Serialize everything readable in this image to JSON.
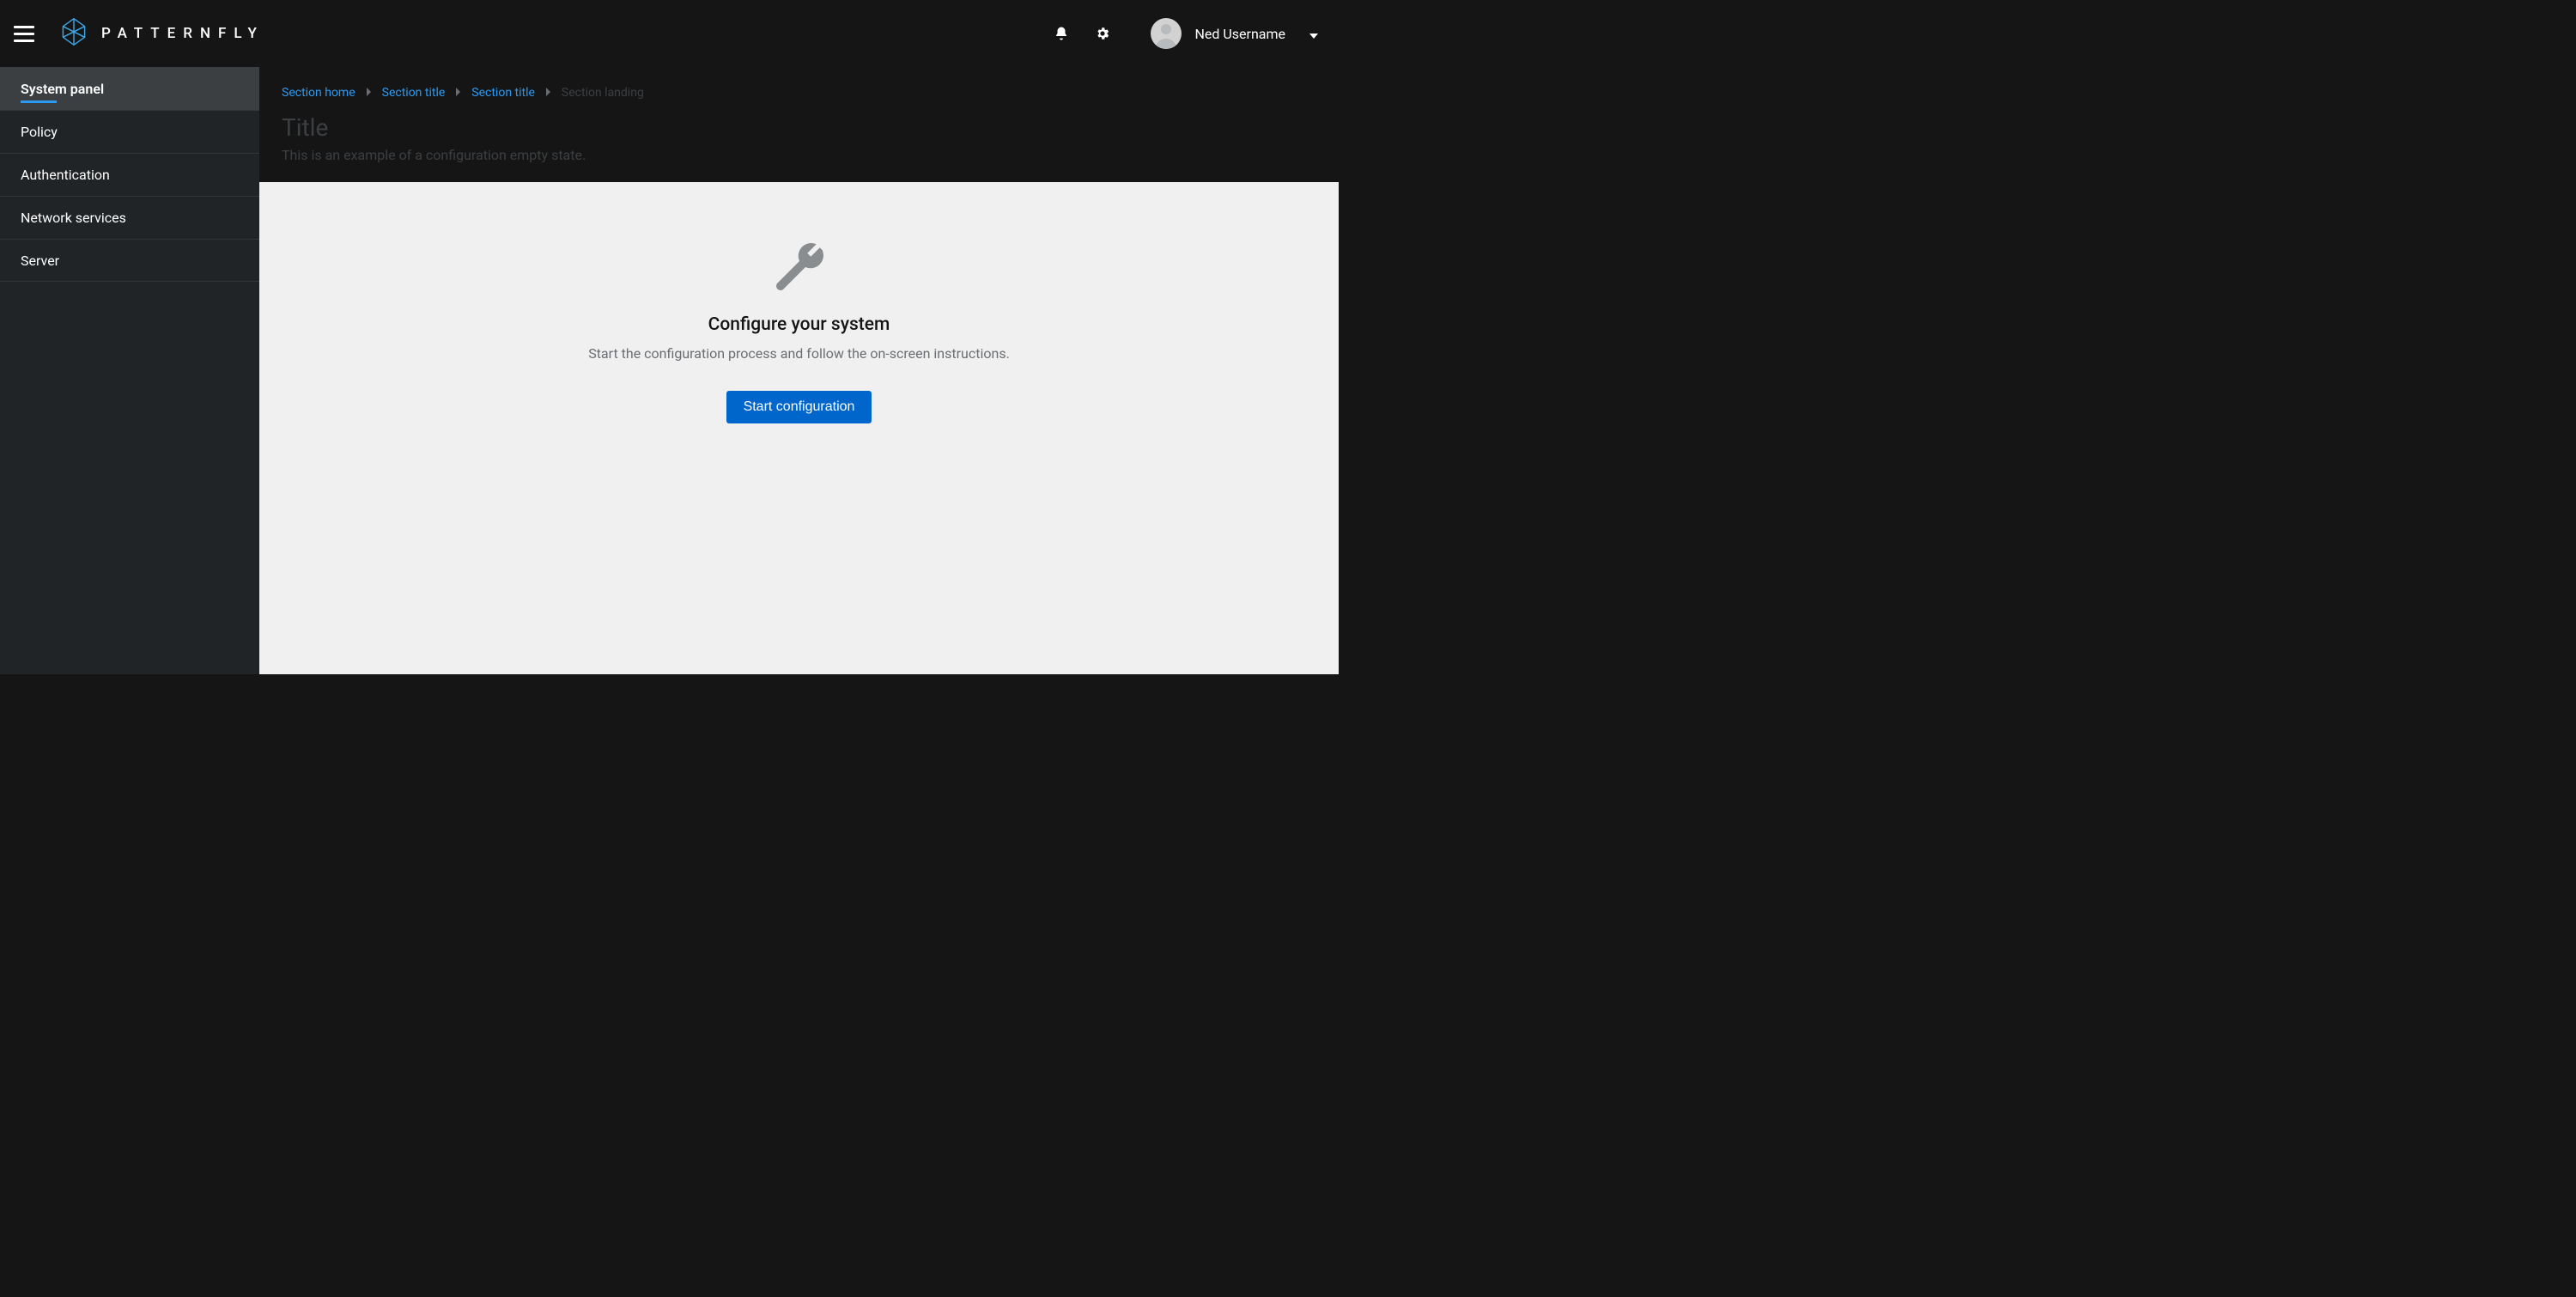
{
  "brand": {
    "name": "PATTERNFLY"
  },
  "header": {
    "user_name": "Ned Username"
  },
  "sidebar": {
    "items": [
      {
        "label": "System panel",
        "current": true
      },
      {
        "label": "Policy",
        "current": false
      },
      {
        "label": "Authentication",
        "current": false
      },
      {
        "label": "Network services",
        "current": false
      },
      {
        "label": "Server",
        "current": false
      }
    ]
  },
  "breadcrumb": {
    "items": [
      {
        "label": "Section home"
      },
      {
        "label": "Section title"
      },
      {
        "label": "Section title"
      }
    ],
    "current": "Section landing"
  },
  "page": {
    "title": "Title",
    "subtitle": "This is an example of a configuration empty state."
  },
  "empty_state": {
    "title": "Configure your system",
    "description": "Start the configuration process and follow the on-screen instructions.",
    "primary_action": "Start configuration"
  }
}
